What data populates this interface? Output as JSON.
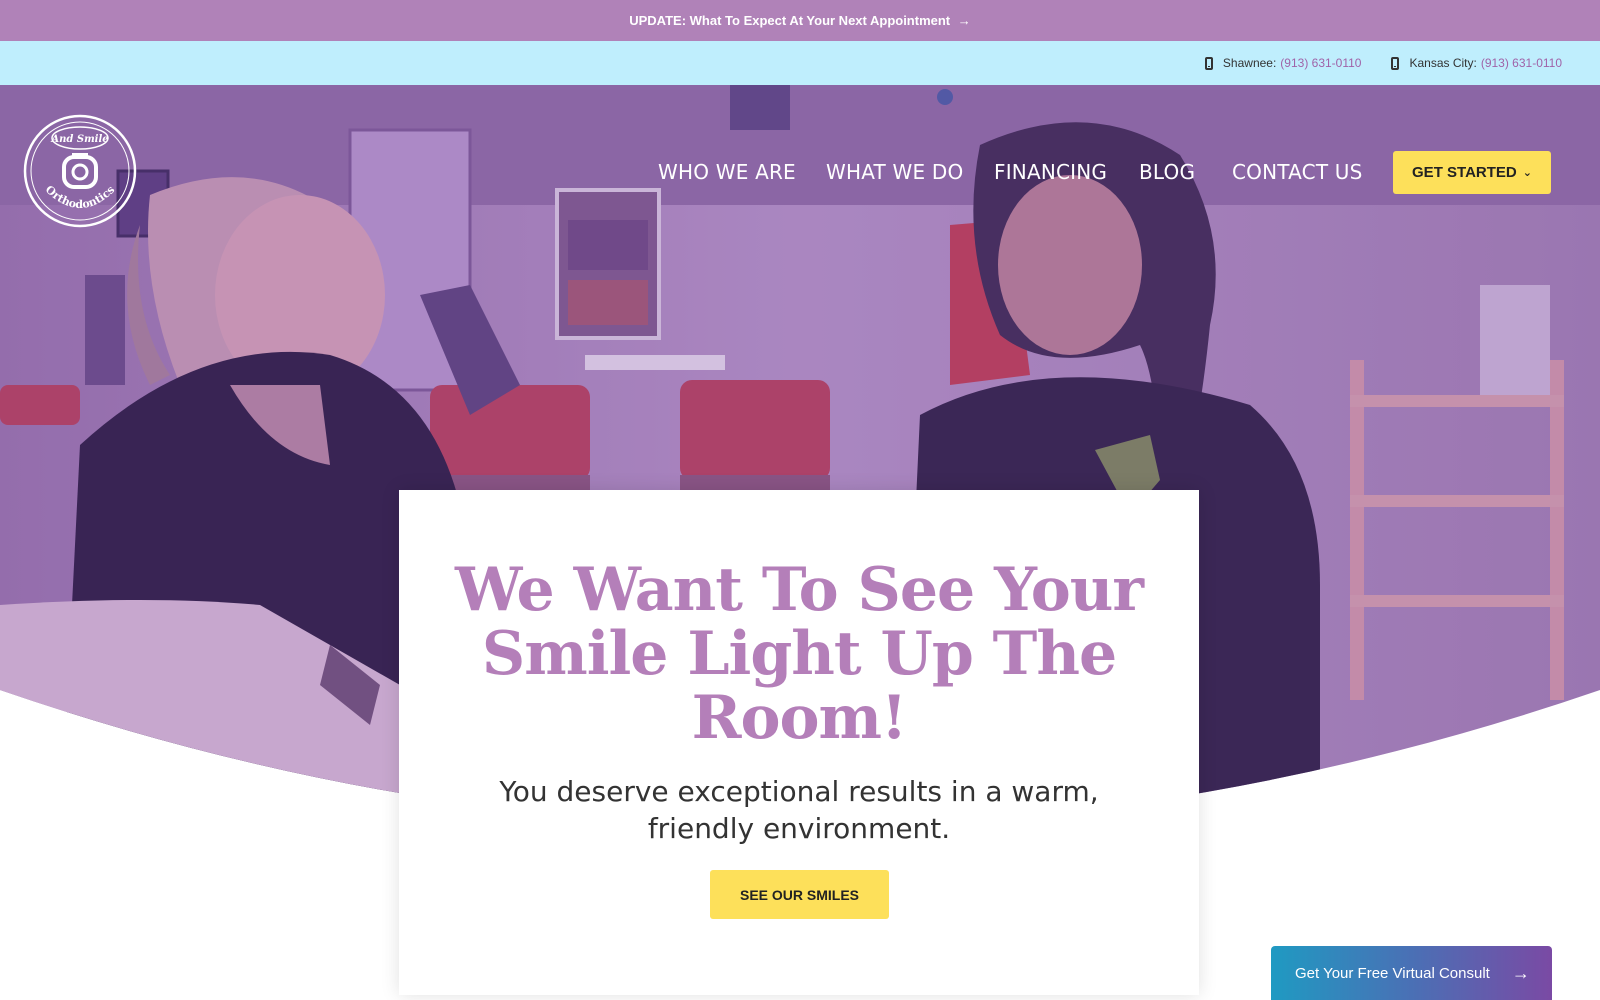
{
  "announcement": {
    "text": "UPDATE: What To Expect At Your Next Appointment",
    "arrow": "→"
  },
  "phones": [
    {
      "label": "Shawnee:",
      "number": "(913) 631-0110",
      "icon": "mobile-phone-icon"
    },
    {
      "label": "Kansas City:",
      "number": "(913) 631-0110",
      "icon": "mobile-phone-icon"
    }
  ],
  "logo": {
    "top_text": "And Smile",
    "bottom_text": "Orthodontics"
  },
  "nav": {
    "items": [
      "WHO WE ARE",
      "WHAT WE DO",
      "FINANCING",
      "BLOG",
      "CONTACT US"
    ],
    "cta": "GET STARTED",
    "cta_icon": "chevron-down-icon"
  },
  "hero": {
    "headline": "We Want To See Your Smile Light Up The Room!",
    "subline": "You deserve exceptional results in a warm, friendly environment.",
    "button": "SEE OUR SMILES"
  },
  "consult": {
    "label": "Get Your Free Virtual Consult",
    "icon": "arrow-right-icon"
  },
  "colors": {
    "announcement_bg": "#b082b8",
    "phone_bar_bg": "#bfeefd",
    "accent_purple": "#b47fb9",
    "button_yellow": "#fde05a",
    "consult_gradient_start": "#1f9ac2",
    "consult_gradient_end": "#7a4aa4"
  }
}
